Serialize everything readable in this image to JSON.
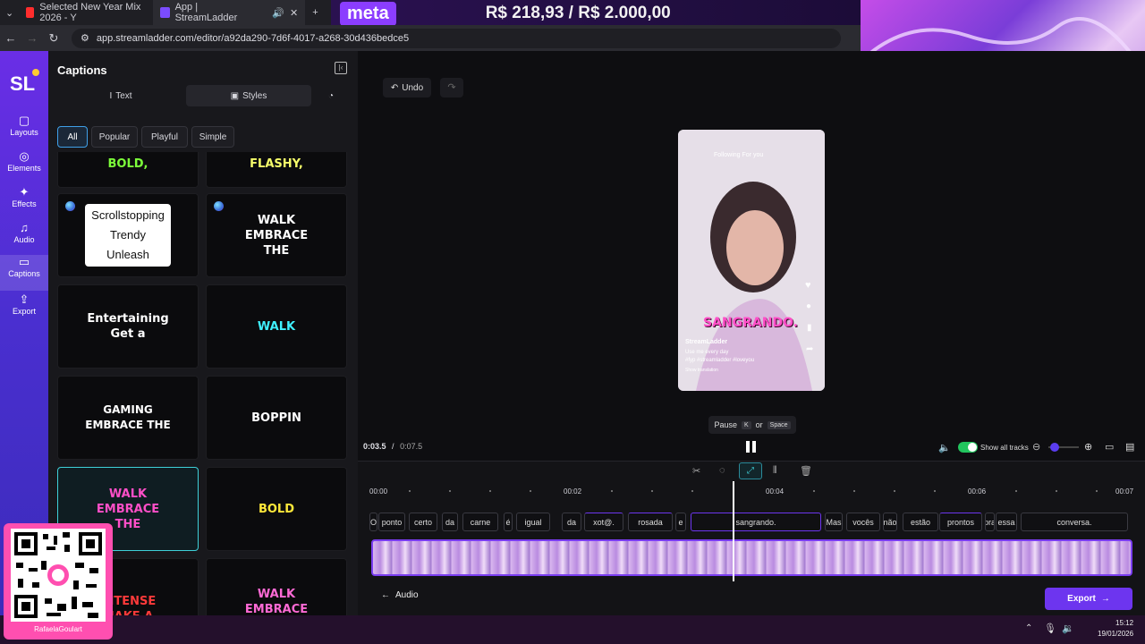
{
  "browser": {
    "tabs": [
      {
        "title": "Selected New Year Mix 2026 - Y",
        "color": "#ff2d2d"
      },
      {
        "title": "App | StreamLadder",
        "color": "#7b4cff"
      }
    ],
    "url": "app.streamladder.com/editor/a92da290-7d6f-4017-a268-30d436bedce5"
  },
  "banner": {
    "logo": "meta",
    "money": "R$ 218,93 / R$ 2.000,00"
  },
  "rail": {
    "logo": "SL",
    "items": [
      {
        "label": "Layouts",
        "icon": "layouts-icon"
      },
      {
        "label": "Elements",
        "icon": "elements-icon"
      },
      {
        "label": "Effects",
        "icon": "effects-icon"
      },
      {
        "label": "Audio",
        "icon": "audio-icon"
      },
      {
        "label": "Captions",
        "icon": "captions-icon"
      },
      {
        "label": "Export",
        "icon": "export-icon"
      }
    ]
  },
  "panel": {
    "title": "Captions",
    "tabs": {
      "text": "Text",
      "styles": "Styles"
    },
    "filters": [
      "All",
      "Popular",
      "Playful",
      "Simple"
    ],
    "cards": [
      {
        "text": "BOLD,",
        "color": "#7dff3a"
      },
      {
        "text": "FLASHY,",
        "color": "#f7ff6a"
      },
      {
        "text": "Scrollstopping Trendy Unleash",
        "color": "#111111"
      },
      {
        "text": "WALK EMBRACE THE",
        "color": "#ffffff"
      },
      {
        "text": "Entertaining Get a",
        "color": "#ffffff"
      },
      {
        "text": "WALK",
        "color": "#3ff0ff"
      },
      {
        "text": "GAMING EMBRACE THE",
        "color": "#ffffff"
      },
      {
        "text": "BOPPIN",
        "color": "#ffffff"
      },
      {
        "text": "WALK EMBRACE THE",
        "color": "#ff4fc8"
      },
      {
        "text": "BOLD",
        "color": "#ffe83a"
      },
      {
        "text": "INTENSE MAKE A",
        "color": "#ff3a3a"
      },
      {
        "text": "WALK EMBRACE THE",
        "color": "#ff6ad5"
      }
    ]
  },
  "editor": {
    "undo": "Undo",
    "tooltip": {
      "label": "Pause",
      "key1": "K",
      "or": "or",
      "key2": "Space"
    },
    "time_current": "0:03.5",
    "time_separator": "/",
    "time_total": "0:07.5",
    "show_all_tracks": "Show all tracks"
  },
  "preview": {
    "caption": "SANGRANDO.",
    "header": "Following  For you",
    "user": "StreamLadder",
    "desc1": "Use me every day",
    "desc2": "#fyp #streamladder #loveyou",
    "translate": "Show translation"
  },
  "timeline": {
    "ticks": [
      "00:00",
      "00:02",
      "00:04",
      "00:06",
      "00:07"
    ],
    "words": [
      "O",
      "ponto",
      "certo",
      "da",
      "carne",
      "é",
      "igual",
      "da",
      "xot@.",
      "rosada",
      "e",
      "sangrando.",
      "Mas",
      "vocês",
      "não",
      "estão",
      "prontos",
      "pra",
      "essa",
      "conversa."
    ],
    "audio": "Audio",
    "export": "Export"
  },
  "overlay": {
    "qr_name": "RafaelaGoulart"
  },
  "taskbar": {
    "time": "15:12",
    "date": "19/01/2026"
  }
}
